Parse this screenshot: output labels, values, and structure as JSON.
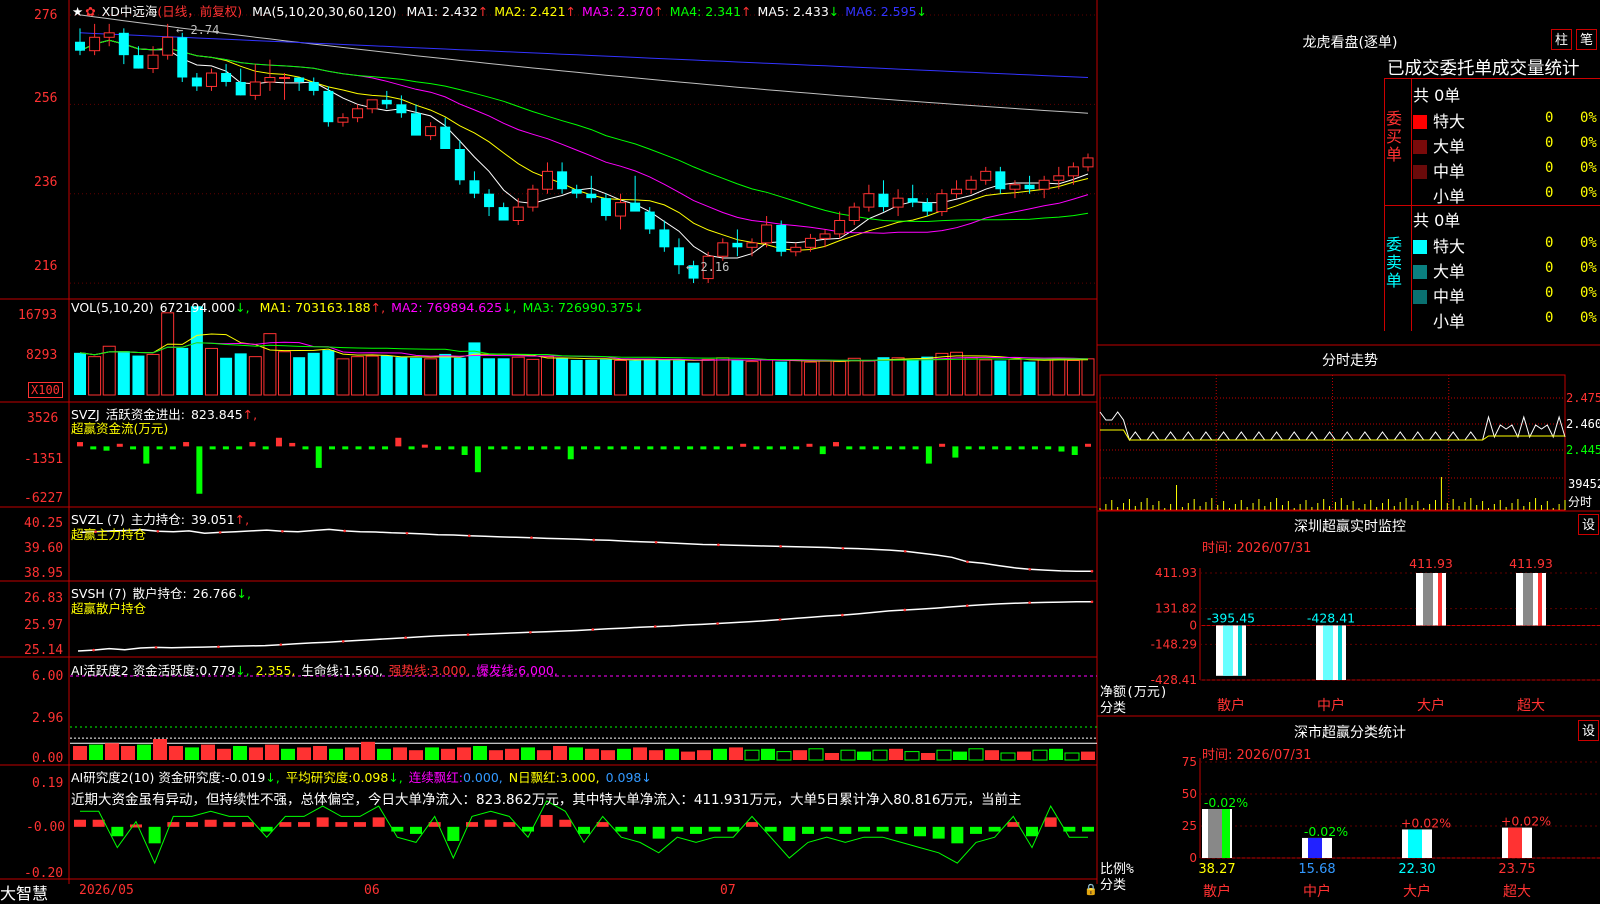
{
  "footer": {
    "brand": "大智慧",
    "dates": [
      "2026/05",
      "06",
      "07"
    ]
  },
  "main_chart": {
    "stock_name": "XD中远海",
    "period": "(日线，前复权)",
    "ma_params": "MA(5,10,20,30,60,120)",
    "ma": [
      {
        "label": "MA1:",
        "value": "2.432",
        "arrow": "↑",
        "color": "#ffffff"
      },
      {
        "label": "MA2:",
        "value": "2.421",
        "arrow": "↑",
        "color": "#ffff00"
      },
      {
        "label": "MA3:",
        "value": "2.370",
        "arrow": "↑",
        "color": "#ff00ff"
      },
      {
        "label": "MA4:",
        "value": "2.341",
        "arrow": "↑",
        "color": "#00ff00"
      },
      {
        "label": "MA5:",
        "value": "2.433",
        "arrow": "↓",
        "color": "#c0c0c0"
      },
      {
        "label": "MA6:",
        "value": "2.595",
        "arrow": "↓",
        "color": "#3333ff"
      }
    ],
    "y_labels": [
      "276",
      "256",
      "236",
      "216"
    ],
    "high_label": "2.74",
    "low_label": "2.16"
  },
  "chart_data": [
    {
      "type": "candlestick",
      "title": "XD中远海(日线，前复权)",
      "ylim": [
        2.14,
        2.78
      ],
      "ohlc": [
        [
          2.7,
          2.73,
          2.67,
          2.68
        ],
        [
          2.68,
          2.74,
          2.67,
          2.71
        ],
        [
          2.71,
          2.74,
          2.69,
          2.72
        ],
        [
          2.72,
          2.73,
          2.65,
          2.67
        ],
        [
          2.67,
          2.69,
          2.64,
          2.64
        ],
        [
          2.64,
          2.69,
          2.63,
          2.67
        ],
        [
          2.67,
          2.74,
          2.66,
          2.71
        ],
        [
          2.71,
          2.72,
          2.61,
          2.62
        ],
        [
          2.62,
          2.63,
          2.59,
          2.6
        ],
        [
          2.6,
          2.64,
          2.59,
          2.63
        ],
        [
          2.63,
          2.65,
          2.6,
          2.61
        ],
        [
          2.61,
          2.64,
          2.58,
          2.58
        ],
        [
          2.58,
          2.65,
          2.57,
          2.61
        ],
        [
          2.61,
          2.66,
          2.59,
          2.62
        ],
        [
          2.62,
          2.63,
          2.57,
          2.62
        ],
        [
          2.62,
          2.62,
          2.59,
          2.61
        ],
        [
          2.61,
          2.62,
          2.58,
          2.59
        ],
        [
          2.59,
          2.6,
          2.51,
          2.52
        ],
        [
          2.52,
          2.54,
          2.51,
          2.53
        ],
        [
          2.53,
          2.56,
          2.52,
          2.55
        ],
        [
          2.55,
          2.57,
          2.54,
          2.57
        ],
        [
          2.57,
          2.59,
          2.55,
          2.56
        ],
        [
          2.56,
          2.58,
          2.53,
          2.54
        ],
        [
          2.54,
          2.56,
          2.51,
          2.49
        ],
        [
          2.49,
          2.52,
          2.48,
          2.51
        ],
        [
          2.51,
          2.53,
          2.49,
          2.46
        ],
        [
          2.46,
          2.48,
          2.38,
          2.39
        ],
        [
          2.39,
          2.41,
          2.35,
          2.36
        ],
        [
          2.36,
          2.37,
          2.31,
          2.33
        ],
        [
          2.33,
          2.34,
          2.3,
          2.3
        ],
        [
          2.3,
          2.35,
          2.29,
          2.33
        ],
        [
          2.33,
          2.38,
          2.32,
          2.37
        ],
        [
          2.37,
          2.43,
          2.36,
          2.41
        ],
        [
          2.41,
          2.43,
          2.36,
          2.37
        ],
        [
          2.37,
          2.38,
          2.35,
          2.36
        ],
        [
          2.36,
          2.4,
          2.34,
          2.35
        ],
        [
          2.35,
          2.36,
          2.3,
          2.31
        ],
        [
          2.31,
          2.36,
          2.28,
          2.34
        ],
        [
          2.34,
          2.4,
          2.33,
          2.32
        ],
        [
          2.32,
          2.33,
          2.27,
          2.28
        ],
        [
          2.28,
          2.3,
          2.23,
          2.24
        ],
        [
          2.24,
          2.26,
          2.18,
          2.2
        ],
        [
          2.2,
          2.21,
          2.16,
          2.17
        ],
        [
          2.17,
          2.23,
          2.16,
          2.22
        ],
        [
          2.22,
          2.26,
          2.21,
          2.25
        ],
        [
          2.25,
          2.28,
          2.22,
          2.24
        ],
        [
          2.24,
          2.26,
          2.22,
          2.25
        ],
        [
          2.25,
          2.31,
          2.24,
          2.29
        ],
        [
          2.29,
          2.3,
          2.22,
          2.23
        ],
        [
          2.23,
          2.25,
          2.22,
          2.24
        ],
        [
          2.24,
          2.27,
          2.23,
          2.26
        ],
        [
          2.26,
          2.28,
          2.24,
          2.27
        ],
        [
          2.27,
          2.32,
          2.26,
          2.3
        ],
        [
          2.3,
          2.34,
          2.29,
          2.33
        ],
        [
          2.33,
          2.38,
          2.32,
          2.36
        ],
        [
          2.36,
          2.39,
          2.32,
          2.33
        ],
        [
          2.33,
          2.37,
          2.31,
          2.35
        ],
        [
          2.35,
          2.38,
          2.33,
          2.34
        ],
        [
          2.34,
          2.35,
          2.31,
          2.32
        ],
        [
          2.32,
          2.37,
          2.31,
          2.36
        ],
        [
          2.36,
          2.39,
          2.35,
          2.37
        ],
        [
          2.37,
          2.4,
          2.36,
          2.39
        ],
        [
          2.39,
          2.42,
          2.38,
          2.41
        ],
        [
          2.41,
          2.42,
          2.36,
          2.37
        ],
        [
          2.37,
          2.39,
          2.35,
          2.38
        ],
        [
          2.38,
          2.4,
          2.36,
          2.37
        ],
        [
          2.37,
          2.4,
          2.35,
          2.39
        ],
        [
          2.39,
          2.42,
          2.37,
          2.4
        ],
        [
          2.4,
          2.43,
          2.38,
          2.42
        ],
        [
          2.42,
          2.45,
          2.41,
          2.44
        ]
      ]
    },
    {
      "type": "bar",
      "title": "VOL(5,10,20)",
      "ylim": [
        0,
        16793
      ],
      "values": [
        7700,
        7000,
        8900,
        8000,
        7200,
        7400,
        15000,
        8600,
        16200,
        8500,
        6800,
        7600,
        7000,
        11200,
        7900,
        6900,
        7700,
        8200,
        6600,
        7000,
        7100,
        7200,
        6900,
        6800,
        6600,
        7500,
        6800,
        9600,
        6700,
        6700,
        6900,
        6500,
        7000,
        6800,
        6400,
        6400,
        6500,
        6300,
        6300,
        6600,
        6500,
        6300,
        5900,
        6500,
        6800,
        6400,
        6100,
        6400,
        6100,
        6400,
        6000,
        6200,
        6100,
        6700,
        6200,
        6900,
        6800,
        6500,
        7000,
        7600,
        7800,
        6800,
        6400,
        6300,
        6500,
        6100,
        6400,
        6700,
        6300,
        6600
      ],
      "series_lines": [
        "MA1: 703163.188",
        "MA2: 769894.625",
        "MA3: 726990.375"
      ]
    },
    {
      "type": "bar",
      "title": "SVZJ 活跃资金进出",
      "ylim": [
        -6227,
        3526
      ],
      "values": [
        500,
        -200,
        -500,
        300,
        -300,
        -2000,
        -150,
        -100,
        500,
        -5500,
        -200,
        -150,
        -300,
        500,
        -250,
        1000,
        400,
        -250,
        -2500,
        -100,
        -300,
        -150,
        -100,
        -300,
        1000,
        -250,
        200,
        -400,
        -150,
        -1000,
        -3000,
        -150,
        -200,
        -250,
        -400,
        -150,
        -150,
        -1500,
        -150,
        -250,
        -150,
        -250,
        -200,
        -300,
        -250,
        -200,
        -100,
        -150,
        -150,
        -200,
        300,
        -200,
        -200,
        -200,
        -100,
        300,
        -900,
        500,
        -200,
        -150,
        -150,
        -300,
        -200,
        -150,
        -2000,
        300,
        -1300,
        -150,
        -250,
        -150,
        -400,
        -200,
        -150,
        -300,
        -600,
        -1000,
        300
      ]
    },
    {
      "type": "line",
      "title": "SVZL 主力持仓",
      "ylim": [
        38.95,
        40.25
      ],
      "values": [
        40.08,
        40.1,
        40.12,
        40.13,
        40.15,
        40.11,
        40.1,
        40.12,
        40.06,
        40.08,
        40.1,
        40.12,
        40.14,
        40.11,
        40.1,
        40.13,
        40.16,
        40.12,
        40.1,
        40.09,
        40.07,
        40.06,
        40.04,
        40.02,
        40.01,
        39.99,
        39.98,
        39.96,
        39.95,
        39.94,
        39.92,
        39.91,
        39.9,
        39.88,
        39.87,
        39.85,
        39.83,
        39.82,
        39.8,
        39.78,
        39.76,
        39.75,
        39.74,
        39.73,
        39.72,
        39.71,
        39.7,
        39.69,
        39.68,
        39.66,
        39.65,
        39.63,
        39.61,
        39.58,
        39.53,
        39.48,
        39.42,
        39.3,
        39.26,
        39.2,
        39.14,
        39.1,
        39.08,
        39.06,
        39.05,
        39.05
      ]
    },
    {
      "type": "line",
      "title": "SVSH 散户持仓",
      "ylim": [
        25.14,
        26.83
      ],
      "values": [
        25.14,
        25.17,
        25.22,
        25.18,
        25.24,
        25.26,
        25.25,
        25.26,
        25.27,
        25.28,
        25.3,
        25.31,
        25.32,
        25.35,
        25.38,
        25.41,
        25.43,
        25.46,
        25.49,
        25.52,
        25.55,
        25.58,
        25.61,
        25.64,
        25.66,
        25.68,
        25.7,
        25.72,
        25.74,
        25.76,
        25.78,
        25.8,
        25.82,
        25.85,
        25.88,
        25.9,
        25.93,
        25.95,
        25.97,
        26.0,
        26.02,
        26.05,
        26.08,
        26.11,
        26.14,
        26.18,
        26.22,
        26.26,
        26.3,
        26.33,
        26.37,
        26.42,
        26.47,
        26.5,
        26.53,
        26.56,
        26.6,
        26.64,
        26.67,
        26.7,
        26.72,
        26.74,
        26.75,
        26.76,
        26.77,
        26.77
      ]
    },
    {
      "type": "bar",
      "title": "AI活跃度2 资金活跃度",
      "ylim": [
        0,
        6.0
      ],
      "values": [
        1.0,
        1.1,
        1.2,
        1.0,
        1.1,
        1.5,
        1.0,
        0.9,
        1.1,
        0.8,
        1.0,
        0.9,
        1.1,
        0.8,
        0.9,
        1.0,
        0.8,
        0.9,
        1.3,
        0.8,
        0.9,
        0.7,
        0.9,
        0.8,
        0.9,
        1.0,
        0.7,
        0.8,
        0.9,
        0.7,
        1.0,
        0.9,
        0.8,
        0.7,
        0.8,
        0.9,
        0.7,
        0.8,
        0.6,
        0.7,
        0.8,
        0.9,
        0.7,
        0.8,
        0.6,
        0.7,
        0.8,
        0.5,
        0.7,
        0.6,
        0.7,
        0.8,
        0.6,
        0.5,
        0.7,
        0.6,
        0.8,
        0.7,
        0.5,
        0.6,
        0.7,
        0.8,
        0.5,
        0.6
      ]
    },
    {
      "type": "bar",
      "title": "AI研究度2(10) 资金研究度",
      "ylim": [
        -0.2,
        0.19
      ],
      "values": [
        0.03,
        0.03,
        -0.04,
        0.01,
        -0.07,
        0.02,
        0.02,
        0.03,
        0.02,
        0.02,
        -0.02,
        0.02,
        0.02,
        0.04,
        0.02,
        0.02,
        0.04,
        -0.02,
        -0.03,
        0.02,
        -0.06,
        0.02,
        0.03,
        0.02,
        -0.02,
        0.05,
        0.03,
        -0.03,
        0.02,
        -0.02,
        -0.03,
        -0.05,
        -0.02,
        -0.03,
        -0.02,
        -0.02,
        0.02,
        -0.02,
        -0.06,
        -0.03,
        -0.02,
        -0.03,
        -0.02,
        -0.02,
        -0.03,
        -0.04,
        -0.05,
        -0.07,
        -0.03,
        -0.02,
        0.02,
        -0.04,
        0.04,
        -0.02,
        -0.02
      ]
    }
  ],
  "vol_panel": {
    "title": "VOL(5,10,20)",
    "value": "672194.000",
    "value_arrow": "↓,",
    "ma": [
      {
        "label": "MA1:",
        "value": "703163.188",
        "arrow": "↑,",
        "color": "#ffff00"
      },
      {
        "label": "MA2:",
        "value": "769894.625",
        "arrow": "↓,",
        "color": "#ff00ff"
      },
      {
        "label": "MA3:",
        "value": "726990.375",
        "arrow": "↓",
        "color": "#00ff00"
      }
    ],
    "y_labels": [
      "16793",
      "8293"
    ],
    "unit": "X100"
  },
  "svzj_panel": {
    "title": "SVZJ",
    "label": "活跃资金进出:",
    "value": "823.845",
    "arrow": "↑,",
    "subtitle": "超赢资金流(万元)",
    "y_labels": [
      "3526",
      "-1351",
      "-6227"
    ]
  },
  "svzl_panel": {
    "title": "SVZL (7)",
    "label": "主力持仓:",
    "value": "39.051",
    "arrow": "↑,",
    "subtitle": "超赢主力持仓",
    "y_labels": [
      "40.25",
      "39.60",
      "38.95"
    ]
  },
  "svsh_panel": {
    "title": "SVSH (7)",
    "label": "散户持仓:",
    "value": "26.766",
    "arrow": "↓,",
    "subtitle": "超赢散户持仓",
    "y_labels": [
      "26.83",
      "25.97",
      "25.14"
    ]
  },
  "ai1_panel": {
    "title": "AI活跃度2 资金活跃度:",
    "value": "0.779",
    "arrow": "↓,",
    "value2": "2.355,",
    "life_label": "生命线:",
    "life_value": "1.560,",
    "strong_label": "强势线:",
    "strong_value": "3.000,",
    "burst_label": "爆发线:",
    "burst_value": "6.000,",
    "y_labels": [
      "6.00",
      "2.96",
      "0.00"
    ]
  },
  "ai2_panel": {
    "title": "AI研究度2(10) 资金研究度:",
    "value": "-0.019",
    "arrow": "↓,",
    "avg_label": "平均研究度:",
    "avg_value": "0.098",
    "avg_arrow": "↓,",
    "lian_label": "连续飘红:",
    "lian_value": "0.000,",
    "n_label": "N日飘红:",
    "n_value": "3.000,",
    "tail": "0.098↓",
    "comment": "近期大资金虽有异动，但持续性不强，总体偏空，今日大单净流入：823.862万元，其中特大单净流入：411.931万元，大单5日累计净入80.816万元，当前主",
    "y_labels": [
      "0.19",
      "-0.00",
      "-0.20"
    ]
  },
  "right_panel": {
    "longhu": {
      "title": "龙虎看盘(逐单)",
      "btn1": "柱",
      "btn2": "笔",
      "subtitle": "已成交委托单成交量统计",
      "buy": {
        "label": "委买单",
        "total": "共 0单",
        "rows": [
          {
            "name": "特大",
            "count": "0",
            "pct": "0%",
            "color": "#ff0000"
          },
          {
            "name": "大单",
            "count": "0",
            "pct": "0%",
            "color": "#7a0a0a"
          },
          {
            "name": "中单",
            "count": "0",
            "pct": "0%",
            "color": "#6a0a0a"
          },
          {
            "name": "小单",
            "count": "0",
            "pct": "0%",
            "color": "#000000"
          }
        ]
      },
      "sell": {
        "label": "委卖单",
        "total": "共 0单",
        "rows": [
          {
            "name": "特大",
            "count": "0",
            "pct": "0%",
            "color": "#00ffff"
          },
          {
            "name": "大单",
            "count": "0",
            "pct": "0%",
            "color": "#0a8080"
          },
          {
            "name": "中单",
            "count": "0",
            "pct": "0%",
            "color": "#0a7070"
          },
          {
            "name": "小单",
            "count": "0",
            "pct": "0%",
            "color": "#000000"
          }
        ]
      }
    },
    "intraday": {
      "title": "分时走势",
      "y_labels": [
        "2.475",
        "2.460",
        "2.445"
      ],
      "vol_label": "39452",
      "vol_unit": "分时"
    },
    "monitor": {
      "title": "深圳超赢实时监控",
      "btn": "设",
      "time": "时间: 2026/07/31",
      "y_labels": [
        "411.93",
        "131.82",
        "0",
        "-148.29",
        "-428.41"
      ],
      "ylabel": "净额(万元)",
      "xlabel": "分类",
      "categories": [
        "散户",
        "中户",
        "大户",
        "超大"
      ],
      "values": [
        -395.45,
        -428.41,
        411.93,
        411.93
      ],
      "value_labels": [
        "-395.45",
        "-428.41",
        "411.93",
        "411.93"
      ]
    },
    "classify": {
      "title": "深市超赢分类统计",
      "btn": "设",
      "time": "时间: 2026/07/31",
      "y_labels": [
        "75",
        "50",
        "25",
        "0"
      ],
      "ylabel": "比例%",
      "xlabel": "分类",
      "categories": [
        "散户",
        "中户",
        "大户",
        "超大"
      ],
      "values": [
        38.27,
        15.68,
        22.3,
        23.75
      ],
      "top_labels": [
        "-0.02%",
        "-0.02%",
        "+0.02%",
        "+0.02%"
      ],
      "bottom_labels": [
        "38.27",
        "15.68",
        "22.30",
        "23.75"
      ]
    }
  },
  "colors": {
    "up": "#ff3232",
    "down": "#00ffff",
    "grid": "#c00000",
    "label_red": "#ff3232",
    "green": "#00ff00",
    "yellow": "#ffff00",
    "magenta": "#ff00ff"
  }
}
